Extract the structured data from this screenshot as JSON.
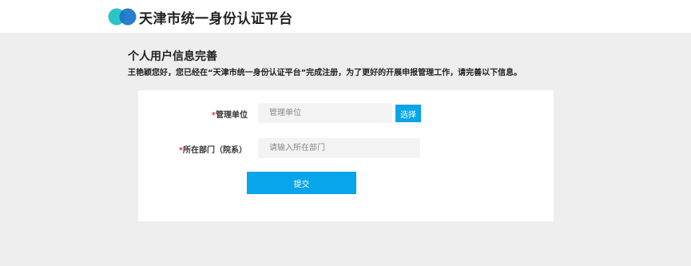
{
  "header": {
    "logo_icon": "two-overlapping-circles-logo",
    "site_title": "天津市统一身份认证平台"
  },
  "main": {
    "page_title": "个人用户信息完善",
    "intro_text": "王艳颖您好，您已经在“天津市统一身份认证平台”完成注册，为了更好的开展申报管理工作，请完善以下信息。"
  },
  "form": {
    "unit": {
      "required_mark": "*",
      "label": "管理单位",
      "value": "",
      "placeholder": "管理单位",
      "select_label": "选择"
    },
    "department": {
      "required_mark": "*",
      "label": "所在部门（院系）",
      "value": "",
      "placeholder": "请输入所在部门"
    },
    "submit_label": "提交"
  },
  "colors": {
    "accent": "#08a5e8",
    "logo_teal": "#2cc3c9",
    "logo_blue": "#1873c6",
    "required": "#e23c2c",
    "page_bg": "#eeeeee"
  }
}
